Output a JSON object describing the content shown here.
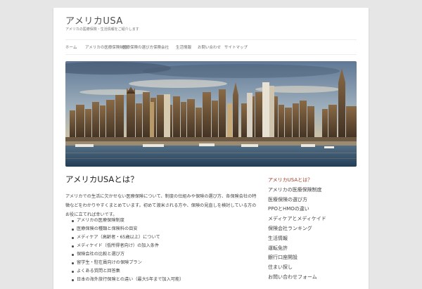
{
  "site": {
    "title": "アメリカUSA",
    "description": "アメリカの医療保険・生活情報をご紹介します"
  },
  "nav": {
    "items": [
      "ホーム",
      "アメリカの医療保険制度",
      "医療保険の選び方",
      "保険会社",
      "生活情報",
      "お問い合わせ",
      "サイトマップ"
    ]
  },
  "hero": {
    "alt": "ニューヨーク・マンハッタンの摩天楼とハドソン川"
  },
  "entry": {
    "title": "アメリカUSAとは？",
    "paragraph": "アメリカでの生活に欠かせない医療保険について、制度の仕組みや保険の選び方、各保険会社の特徴などをわかりやすくまとめています。初めて渡米される方や、保険の見直しを検討している方のお役に立てれば幸いです。",
    "list": [
      "アメリカの医療保険制度",
      "医療保険の種類と保険料の目安",
      "メディケア（高齢者・65歳以上）について",
      "メディケイド（低所得者向け）の加入条件",
      "保険会社の比較と選び方",
      "留学生・駐在員向けの保険プラン",
      "よくある質問と回答集",
      "日本の海外旅行保険との違い（最大5年まで加入可能）"
    ]
  },
  "sidebar": {
    "items": [
      "アメリカUSAとは？",
      "アメリカの医療保険制度",
      "医療保険の選び方",
      "PPOとHMOの違い",
      "メディケアとメディケイド",
      "保険会社ランキング",
      "生活情報",
      "運転免許",
      "銀行口座開設",
      "住まい探し",
      "お問い合わせフォーム"
    ]
  },
  "colors": {
    "background": "#e6e6e6",
    "page": "#ffffff",
    "accent": "#a33a24",
    "text": "#444444"
  }
}
